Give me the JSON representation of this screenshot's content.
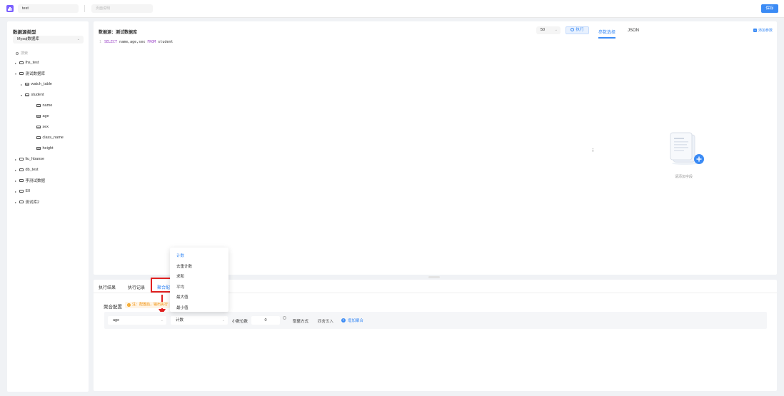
{
  "topbar": {
    "name_value": "test",
    "desc_placeholder": "页面说明",
    "save_label": "保存"
  },
  "sidebar": {
    "title": "数据源类型",
    "db_type": "Mysql数据库",
    "search_placeholder": "搜索",
    "tree": [
      {
        "label": "lhs_test",
        "kind": "db",
        "level": 0,
        "expanded": false
      },
      {
        "label": "测试数据库",
        "kind": "db",
        "level": 0,
        "expanded": true
      },
      {
        "label": "watch_table",
        "kind": "table",
        "level": 1,
        "expanded": false
      },
      {
        "label": "student",
        "kind": "table",
        "level": 1,
        "expanded": true
      },
      {
        "label": "name",
        "kind": "column",
        "level": 2
      },
      {
        "label": "age",
        "kind": "column",
        "level": 2
      },
      {
        "label": "sex",
        "kind": "column",
        "level": 2
      },
      {
        "label": "class_name",
        "kind": "column",
        "level": 2
      },
      {
        "label": "height",
        "kind": "column",
        "level": 2
      },
      {
        "label": "liu_hbanse",
        "kind": "db",
        "level": 0,
        "expanded": false
      },
      {
        "label": "db_test",
        "kind": "db",
        "level": 0,
        "expanded": false
      },
      {
        "label": "李测试数据",
        "kind": "db",
        "level": 0,
        "expanded": false
      },
      {
        "label": "E0",
        "kind": "db",
        "level": 0,
        "expanded": false
      },
      {
        "label": "测试库2",
        "kind": "db",
        "level": 0,
        "expanded": false
      }
    ]
  },
  "editor": {
    "title": "数据源：测试数据库",
    "limit_value": "50",
    "run_label": "执行",
    "tab_params": "参数选择",
    "tab_json": "JSON",
    "add_param_label": "添加参数",
    "sql": {
      "line_number": "1",
      "kw_select": "SELECT",
      "fields": "name,age,sex",
      "kw_from": "FROM",
      "table": "student"
    },
    "empty_text": "请添加字段"
  },
  "bottom": {
    "tabs": [
      "执行结果",
      "执行记录",
      "聚合配"
    ],
    "agg_label": "聚合配置",
    "agg_note": "注：配置后，输出执行",
    "field_value": "age",
    "func_value": "计数",
    "decimal_label": "小数位数",
    "decimal_value": "0",
    "round_label": "取整方式",
    "round_value": "四舍五入",
    "add_agg_label": "增加聚合"
  },
  "dropdown": {
    "options": [
      "计数",
      "去重计数",
      "求和",
      "平均",
      "最大值",
      "最小值"
    ],
    "selected_index": 0
  },
  "colors": {
    "accent": "#3b8bf5",
    "annotation_red": "#e02020",
    "logo_purple": "#7b61ff"
  }
}
